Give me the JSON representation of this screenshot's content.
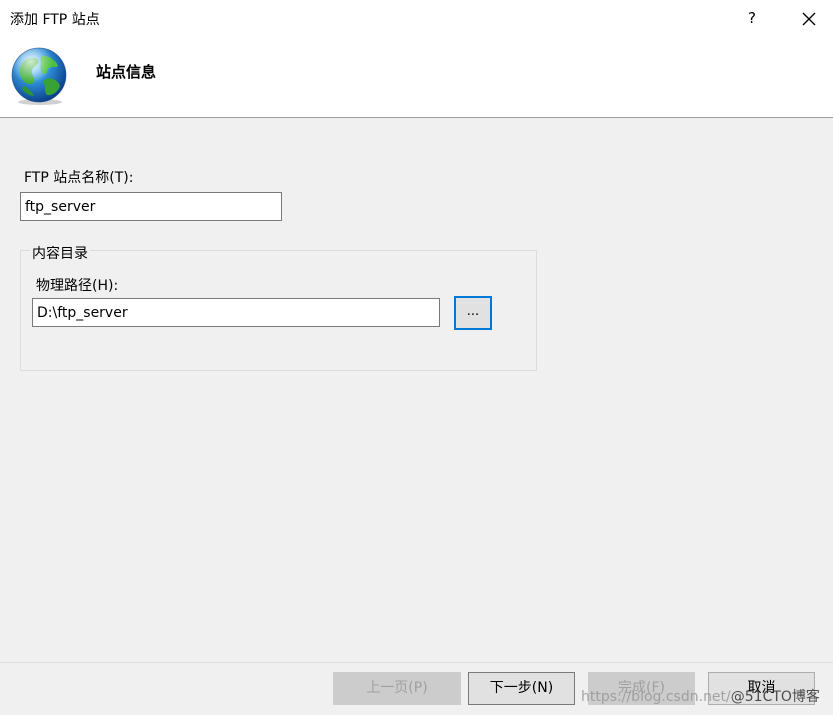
{
  "window": {
    "title": "添加 FTP 站点",
    "help_label": "?"
  },
  "header": {
    "title": "站点信息",
    "icon": "globe-icon"
  },
  "form": {
    "site_name_label": "FTP 站点名称(T):",
    "site_name_value": "ftp_server",
    "content_group_label": "内容目录",
    "physical_path_label": "物理路径(H):",
    "physical_path_value": "D:\\ftp_server",
    "browse_label": "..."
  },
  "footer": {
    "prev_label": "上一页(P)",
    "next_label": "下一步(N)",
    "finish_label": "完成(F)",
    "cancel_label": "取消"
  },
  "watermark": {
    "url": "https://blog.csdn.net/",
    "brand": "@51CTO博客"
  },
  "colors": {
    "accent": "#0078d7",
    "header_bg": "#ffffff",
    "body_bg": "#f0f0f0"
  }
}
